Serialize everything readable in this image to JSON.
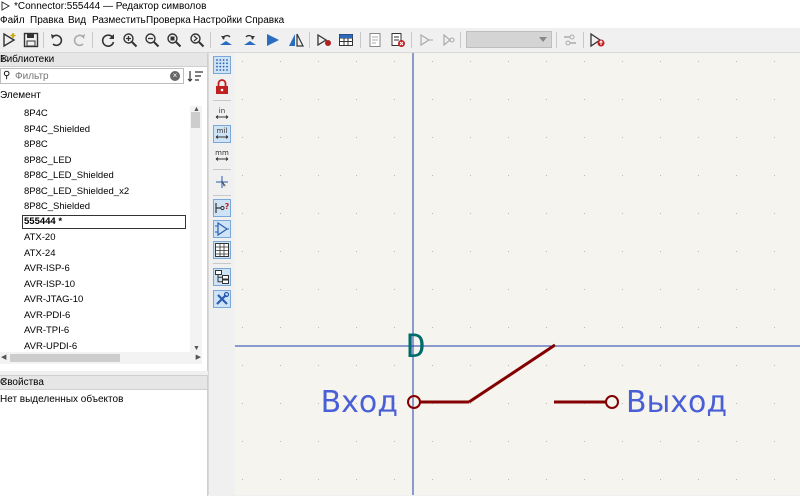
{
  "window": {
    "title": "*Connector:555444 — Редактор символов"
  },
  "menu": [
    "Файл",
    "Правка",
    "Вид",
    "Разместить",
    "Проверка",
    "Настройки",
    "Справка"
  ],
  "toolbar": {
    "icons": [
      "new-symbol-icon",
      "save-icon",
      "undo-icon",
      "redo-icon",
      "refresh-icon",
      "zoom-in-icon",
      "zoom-out-icon",
      "zoom-fit-icon",
      "zoom-selection-icon",
      "rotate-ccw-icon",
      "rotate-cw-icon",
      "mirror-horizontal-icon",
      "mirror-vertical-icon",
      "symbol-properties-icon",
      "pin-table-icon",
      "datasheet-icon",
      "electrical-rules-check-icon",
      "unit-icon",
      "body-style-icon",
      "unit-selector",
      "sync-pins-icon",
      "update-symbol-icon"
    ],
    "unit_selector_value": ""
  },
  "libraries": {
    "title": "Библиотеки",
    "filter_placeholder": "Фильтр",
    "column_header": "Элемент",
    "items": [
      "8P4C",
      "8P4C_Shielded",
      "8P8C",
      "8P8C_LED",
      "8P8C_LED_Shielded",
      "8P8C_LED_Shielded_x2",
      "8P8C_Shielded",
      "555444 *",
      "ATX-20",
      "ATX-24",
      "AVR-ISP-6",
      "AVR-ISP-10",
      "AVR-JTAG-10",
      "AVR-PDI-6",
      "AVR-TPI-6",
      "AVR-UPDI-6"
    ],
    "selected_index": 7
  },
  "properties": {
    "title": "Свойства",
    "empty_text": "Нет выделенных объектов"
  },
  "side_toolbar": {
    "icons": [
      "grid-icon",
      "lock-icon",
      "units-inch-icon",
      "units-mil-icon",
      "units-mm-icon",
      "cursor-icon",
      "pin-type-icon",
      "symbol-pins-icon",
      "pin-table-icon",
      "hierarchy-icon",
      "tools-icon"
    ],
    "labels": {
      "inch": "in",
      "mil": "mil",
      "mm": "mm"
    },
    "active": [
      "grid-icon",
      "units-mil-icon"
    ]
  },
  "schematic": {
    "reference": "D",
    "pin_in_label": "Вход",
    "pin_out_label": "Выход",
    "colors": {
      "pin": "#840000",
      "label": "#4a5fd6",
      "reference": "#006b6b",
      "axis": "#1f3fae",
      "background": "#f5f4ef"
    }
  }
}
